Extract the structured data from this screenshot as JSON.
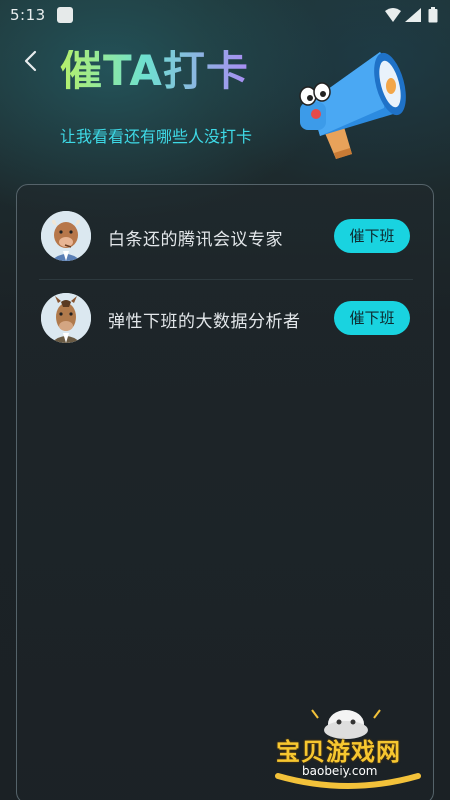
{
  "status_bar": {
    "time": "5:13"
  },
  "header": {
    "title": "催TA打卡",
    "subtitle": "让我看看还有哪些人没打卡"
  },
  "list": {
    "items": [
      {
        "name": "白条还的腾讯会议专家",
        "button": "催下班"
      },
      {
        "name": "弹性下班的大数据分析者",
        "button": "催下班"
      }
    ]
  },
  "watermark": {
    "text": "宝贝游戏网",
    "url": "baobeiy.com"
  },
  "colors": {
    "accent": "#19d3e0",
    "subtitle": "#3ed9e6",
    "background": "#1b2125"
  },
  "icons": {
    "back": "chevron-left-icon",
    "megaphone": "megaphone-mascot-icon"
  }
}
